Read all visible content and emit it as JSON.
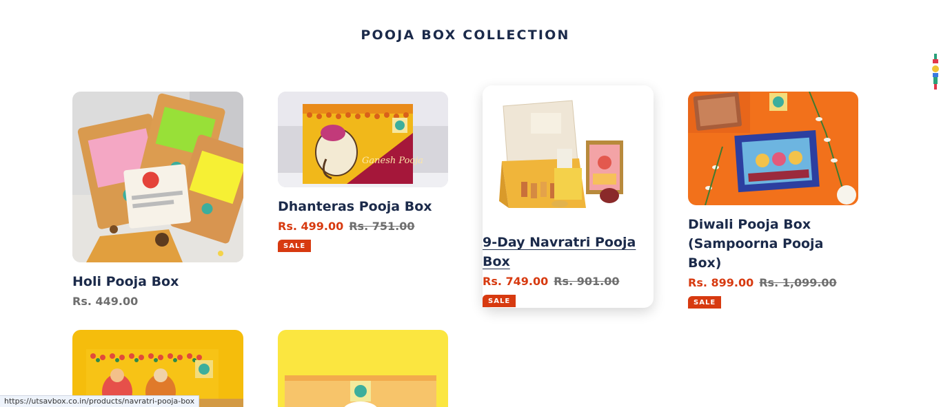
{
  "section": {
    "title": "POOJA BOX COLLECTION"
  },
  "products": [
    {
      "title": "Holi Pooja Box",
      "price": "Rs. 449.00",
      "on_sale": false
    },
    {
      "title": "Dhanteras Pooja Box",
      "sale_price": "Rs. 499.00",
      "compare_price": "Rs. 751.00",
      "badge": "SALE",
      "image_text": "Ganesh Pooja",
      "on_sale": true
    },
    {
      "title": "9-Day Navratri Pooja Box",
      "sale_price": "Rs. 749.00",
      "compare_price": "Rs. 901.00",
      "badge": "SALE",
      "on_sale": true,
      "hovered": true
    },
    {
      "title": "Diwali Pooja Box (Sampoorna Pooja Box)",
      "sale_price": "Rs. 899.00",
      "compare_price": "Rs. 1,099.00",
      "badge": "SALE",
      "on_sale": true
    }
  ],
  "status_bar": {
    "url": "https://utsavbox.co.in/products/navratri-pooja-box"
  },
  "colors": {
    "navy": "#1b2a4a",
    "sale_red": "#d73a10",
    "muted_gray": "#6e6e6e"
  },
  "icons": {
    "side_widget": "decorative-lantern-icon"
  }
}
